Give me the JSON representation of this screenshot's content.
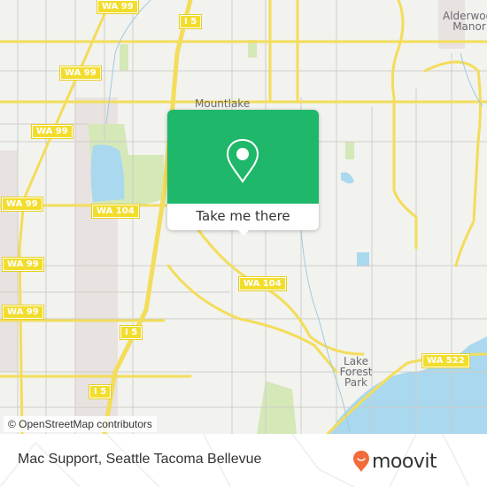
{
  "map": {
    "colors": {
      "land": "#f2f2ee",
      "water": "#a9d8ef",
      "park": "#d4e8b8",
      "urban": "#e6e0de",
      "highway": "#f3dd5a",
      "minor_road": "#c8c6c2"
    },
    "shields": [
      {
        "label": "WA 99"
      },
      {
        "label": "I 5"
      },
      {
        "label": "WA 99"
      },
      {
        "label": "WA 99"
      },
      {
        "label": "WA 99"
      },
      {
        "label": "WA 104"
      },
      {
        "label": "WA 99"
      },
      {
        "label": "WA 104"
      },
      {
        "label": "WA 99"
      },
      {
        "label": "I 5"
      },
      {
        "label": "I 5"
      },
      {
        "label": "WA 522"
      }
    ],
    "places": [
      {
        "label": "Mountlake"
      },
      {
        "label": "Alderwood Manor"
      },
      {
        "label": "Lake Forest Park"
      }
    ],
    "attribution": "© OpenStreetMap contributors"
  },
  "popup": {
    "icon": "map-pin-icon",
    "accent_color": "#1fb76a",
    "button_label": "Take me there"
  },
  "footer": {
    "title": "Mac Support, Seattle Tacoma Bellevue",
    "logo_text": "moovit",
    "logo_icon": "moovit-smiley-pin-icon",
    "logo_color": "#f26b3a"
  }
}
